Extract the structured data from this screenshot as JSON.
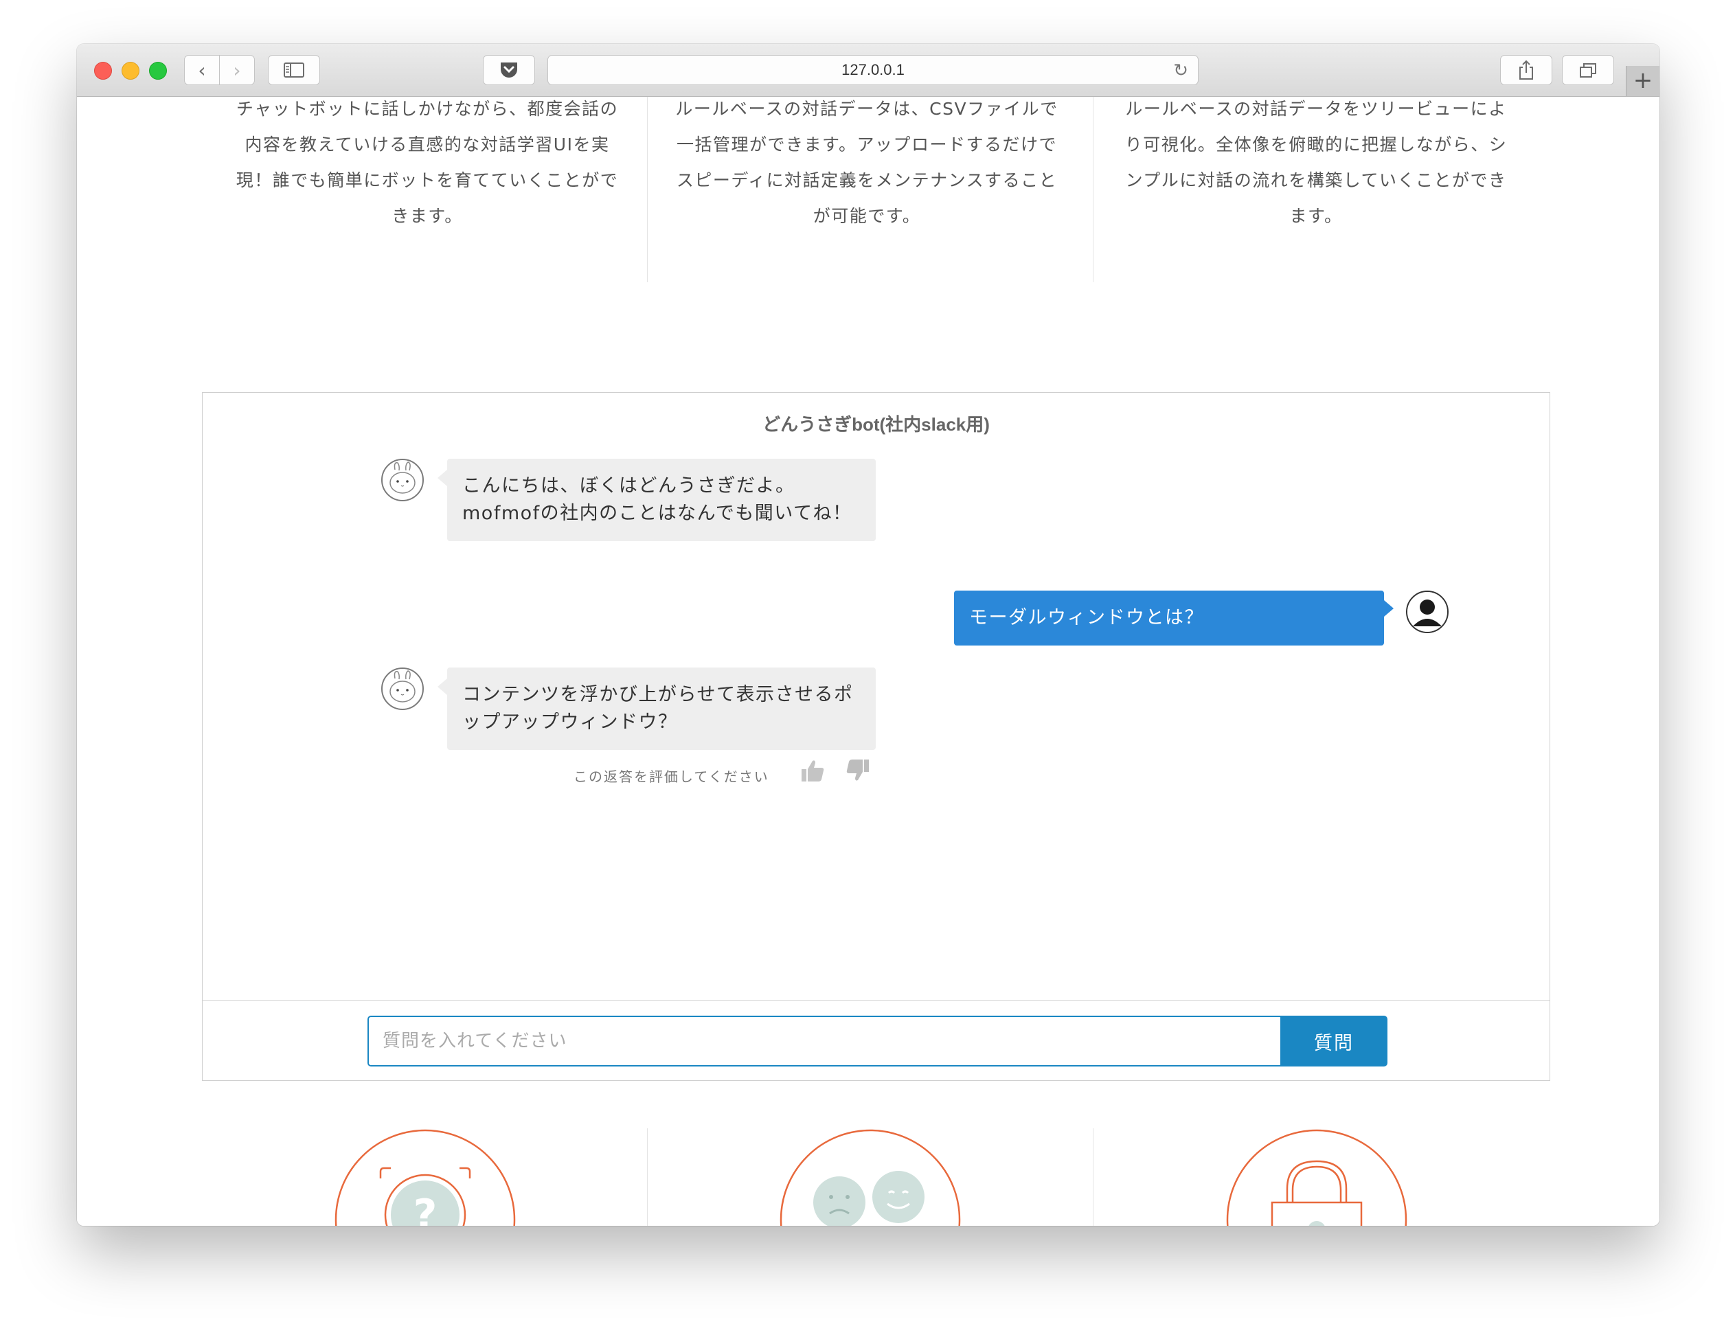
{
  "browser": {
    "url": "127.0.0.1",
    "icons": {
      "back": "chevron-left-icon",
      "forward": "chevron-right-icon",
      "sidebar": "sidebar-icon",
      "pocket": "pocket-icon",
      "reload": "reload-icon",
      "share": "share-icon",
      "tabs": "tabs-icon",
      "new_tab": "plus-icon"
    }
  },
  "features": [
    {
      "text": "チャットボットに話しかけながら、都度会話の内容を教えていける直感的な対話学習UIを実現！誰でも簡単にボットを育てていくことができます。"
    },
    {
      "text": "ルールベースの対話データは、CSVファイルで一括管理ができます。アップロードするだけでスピーディに対話定義をメンテナンスすることが可能です。"
    },
    {
      "text": "ルールベースの対話データをツリービューにより可視化。全体像を俯瞰的に把握しながら、シンプルに対話の流れを構築していくことができます。"
    }
  ],
  "chat": {
    "title": "どんうさぎbot(社内slack用)",
    "messages": [
      {
        "sender": "bot",
        "text": "こんにちは、ぼくはどんうさぎだよ。mofmofの社内のことはなんでも聞いてね！"
      },
      {
        "sender": "user",
        "text": "モーダルウィンドウとは？"
      },
      {
        "sender": "bot",
        "text": "コンテンツを浮かび上がらせて表示させるポップアップウィンドウ？"
      }
    ],
    "rating_prompt": "この返答を評価してください",
    "input_placeholder": "質問を入れてください",
    "input_value": "",
    "submit_label": "質問"
  },
  "colors": {
    "user_bubble": "#2b88d9",
    "bot_bubble": "#eeeeee",
    "accent": "#1a87c3",
    "feature_icon_stroke": "#e8693c",
    "feature_icon_fill": "#cfe0dc"
  }
}
